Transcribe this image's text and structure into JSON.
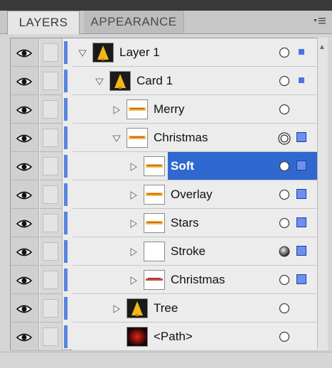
{
  "tabs": [
    "LAYERS",
    "APPEARANCE"
  ],
  "layers": [
    {
      "name": "Layer 1",
      "level": 0,
      "expanded": true,
      "has_arrow": true,
      "thumb": "tree-icon",
      "target": "empty",
      "selection": "small"
    },
    {
      "name": "Card 1",
      "level": 1,
      "expanded": true,
      "has_arrow": true,
      "thumb": "tree-icon",
      "target": "empty",
      "selection": "small"
    },
    {
      "name": "Merry",
      "level": 2,
      "expanded": false,
      "has_arrow": true,
      "thumb": "text-art-icon",
      "target": "empty",
      "selection": "none"
    },
    {
      "name": "Christmas",
      "level": 2,
      "expanded": true,
      "has_arrow": true,
      "thumb": "text-art-icon",
      "target": "double",
      "selection": "big"
    },
    {
      "name": "Soft",
      "level": 3,
      "expanded": false,
      "has_arrow": true,
      "thumb": "text-art-icon",
      "target": "empty",
      "selection": "big",
      "selected": true
    },
    {
      "name": "Overlay",
      "level": 3,
      "expanded": false,
      "has_arrow": true,
      "thumb": "text-art-icon",
      "target": "empty",
      "selection": "big"
    },
    {
      "name": "Stars",
      "level": 3,
      "expanded": false,
      "has_arrow": true,
      "thumb": "text-art-icon",
      "target": "empty",
      "selection": "big"
    },
    {
      "name": "Stroke",
      "level": 3,
      "expanded": false,
      "has_arrow": true,
      "thumb": "blank-icon",
      "target": "filled",
      "selection": "big"
    },
    {
      "name": "Christmas",
      "level": 3,
      "expanded": false,
      "has_arrow": true,
      "thumb": "text-art-red-icon",
      "target": "empty",
      "selection": "big"
    },
    {
      "name": "Tree",
      "level": 2,
      "expanded": false,
      "has_arrow": true,
      "thumb": "tree-icon",
      "target": "empty",
      "selection": "none"
    },
    {
      "name": "<Path>",
      "level": 2,
      "expanded": false,
      "has_arrow": false,
      "thumb": "red-glow-icon",
      "target": "empty",
      "selection": "none"
    }
  ],
  "colors": {
    "layer_color": "#5a84e0",
    "selected_bg": "#2f68cf"
  }
}
